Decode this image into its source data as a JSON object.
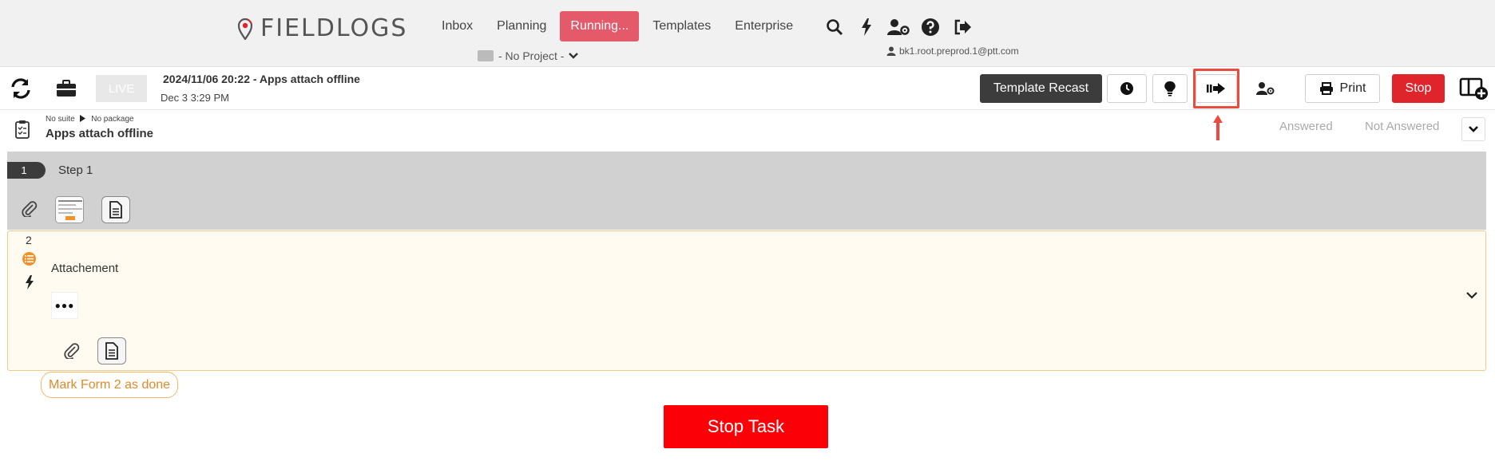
{
  "brand": {
    "name": "FIELDLOGS"
  },
  "nav": {
    "items": [
      {
        "label": "Inbox",
        "active": false
      },
      {
        "label": "Planning",
        "active": false
      },
      {
        "label": "Running...",
        "active": true
      },
      {
        "label": "Templates",
        "active": false
      },
      {
        "label": "Enterprise",
        "active": false
      }
    ],
    "icons": [
      "search-icon",
      "bolt-icon",
      "user-settings-icon",
      "help-icon",
      "logout-icon"
    ]
  },
  "project": {
    "label": "- No Project -"
  },
  "user": {
    "email": "bk1.root.preprod.1@ptt.com"
  },
  "task": {
    "live_label": "LIVE",
    "title": "2024/11/06 20:22 - Apps attach offline",
    "date": "Dec 3 3:29 PM",
    "buttons": {
      "template_recast": "Template Recast",
      "print": "Print",
      "stop": "Stop"
    }
  },
  "suite": {
    "suite_label": "No suite",
    "package_label": "No package",
    "name": "Apps attach offline",
    "answered": "Answered",
    "not_answered": "Not Answered"
  },
  "steps": [
    {
      "number": "1",
      "label": "Step 1"
    },
    {
      "number": "2",
      "label": "Attachement",
      "dots": "●●●"
    }
  ],
  "actions": {
    "mark_done": "Mark Form 2 as done",
    "stop_task": "Stop Task"
  },
  "colors": {
    "accent_running": "#e45a6a",
    "stop_red": "#e0242b",
    "stop_task_red": "#fb0007",
    "highlight": "#ea4b3f",
    "form_border": "#f3c98b",
    "orange": "#f0922a"
  }
}
